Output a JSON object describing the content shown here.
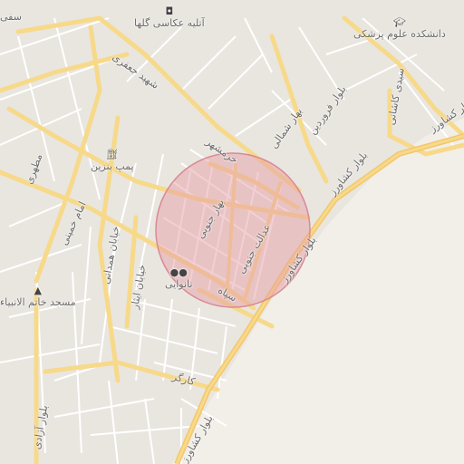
{
  "map": {
    "streets": {
      "keshavarz_1": "بلوار کشاورز",
      "keshavarz_2": "بلوار کشاورز",
      "keshavarz_3": "بلوار کشاورز",
      "keshavarz_4": "بلوار کشاورز",
      "farvardin": "بلوار فروردین",
      "bahar_shomali": "بهار شمالی",
      "bahar_jonoobi": "بهار جنوبی",
      "edalat_jonoobi": "عدالت جنوبی",
      "khorramshahr": "خرمشهر",
      "shahid_jafari": "شهید جعفری",
      "sepah": "سپاه",
      "imam_khomeini": "امام خمینی",
      "khayyam_hamedani": "خیابان همدانی",
      "khayyam_enghelab": "خیابان ایثار",
      "motahari": "مطهری",
      "karegar": "کارگر",
      "azadi": "بلوار آزادی",
      "seyyed_kashani": "سیدی کاشانی",
      "safi": "سفی"
    },
    "pois": {
      "photo_studio": "آتلیه عکاسی گلها",
      "medical_university": "دانشکده علوم پزشکی",
      "gas_station": "پمپ بنزین",
      "bakery": "نانوایی",
      "mosque": "مسجد خاتم الانبیاء"
    },
    "highlight": {
      "color": "#e8a0a8"
    }
  }
}
